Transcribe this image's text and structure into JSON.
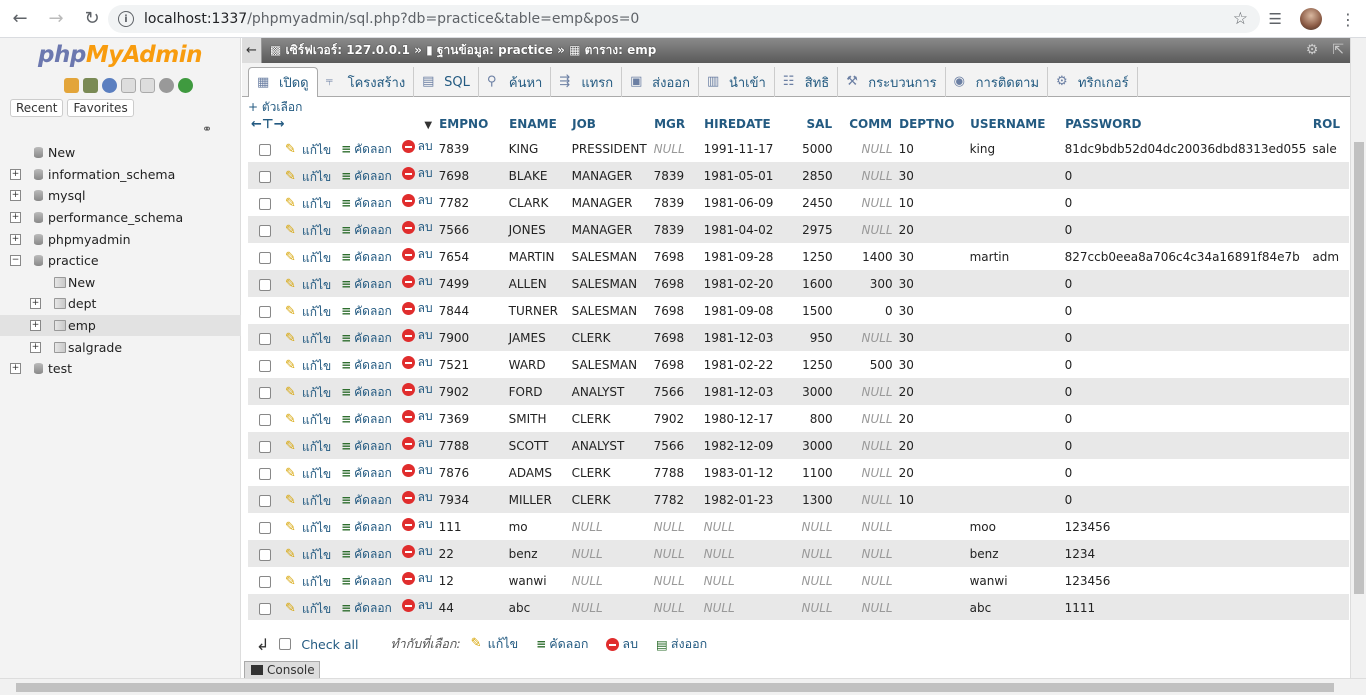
{
  "browser": {
    "url_host": "localhost:1337",
    "url_path": "/phpmyadmin/sql.php?db=practice&table=emp&pos=0"
  },
  "sidebar": {
    "logo_php": "php",
    "logo_myadmin": "MyAdmin",
    "tabs": [
      "Recent",
      "Favorites"
    ],
    "tree": [
      {
        "label": "New",
        "level": 0,
        "expander": "",
        "icon": "new-db-icon"
      },
      {
        "label": "information_schema",
        "level": 0,
        "expander": "+",
        "icon": "database-icon"
      },
      {
        "label": "mysql",
        "level": 0,
        "expander": "+",
        "icon": "database-icon"
      },
      {
        "label": "performance_schema",
        "level": 0,
        "expander": "+",
        "icon": "database-icon"
      },
      {
        "label": "phpmyadmin",
        "level": 0,
        "expander": "+",
        "icon": "database-icon"
      },
      {
        "label": "practice",
        "level": 0,
        "expander": "−",
        "icon": "database-icon"
      },
      {
        "label": "New",
        "level": 1,
        "expander": "",
        "icon": "new-table-icon"
      },
      {
        "label": "dept",
        "level": 1,
        "expander": "+",
        "icon": "table-icon"
      },
      {
        "label": "emp",
        "level": 1,
        "expander": "+",
        "icon": "table-icon",
        "selected": true
      },
      {
        "label": "salgrade",
        "level": 1,
        "expander": "+",
        "icon": "table-icon"
      },
      {
        "label": "test",
        "level": 0,
        "expander": "+",
        "icon": "database-icon"
      }
    ]
  },
  "breadcrumb": {
    "server": "เซิร์ฟเวอร์: 127.0.0.1",
    "database": "ฐานข้อมูล: practice",
    "table": "ตาราง: emp"
  },
  "tabs": [
    {
      "label": "เปิดดู",
      "icon": "browse-icon",
      "active": true
    },
    {
      "label": "โครงสร้าง",
      "icon": "structure-icon"
    },
    {
      "label": "SQL",
      "icon": "sql-icon"
    },
    {
      "label": "ค้นหา",
      "icon": "search-icon"
    },
    {
      "label": "แทรก",
      "icon": "insert-icon"
    },
    {
      "label": "ส่งออก",
      "icon": "export-icon"
    },
    {
      "label": "นำเข้า",
      "icon": "import-icon"
    },
    {
      "label": "สิทธิ",
      "icon": "privileges-icon"
    },
    {
      "label": "กระบวนการ",
      "icon": "operations-icon"
    },
    {
      "label": "การติดตาม",
      "icon": "tracking-icon"
    },
    {
      "label": "ทริกเกอร์",
      "icon": "triggers-icon"
    }
  ],
  "options_label": "+ ตัวเลือก",
  "table": {
    "columns": [
      "EMPNO",
      "ENAME",
      "JOB",
      "MGR",
      "HIREDATE",
      "SAL",
      "COMM",
      "DEPTNO",
      "USERNAME",
      "PASSWORD",
      "ROL"
    ],
    "action_edit": "แก้ไข",
    "action_copy": "คัดลอก",
    "action_delete": "ลบ",
    "null_text": "NULL",
    "rows": [
      [
        "7839",
        "KING",
        "PRESSIDENT",
        "NULL",
        "1991-11-17",
        "5000",
        "NULL",
        "10",
        "king",
        "81dc9bdb52d04dc20036dbd8313ed055",
        "sale"
      ],
      [
        "7698",
        "BLAKE",
        "MANAGER",
        "7839",
        "1981-05-01",
        "2850",
        "NULL",
        "30",
        "",
        "0",
        ""
      ],
      [
        "7782",
        "CLARK",
        "MANAGER",
        "7839",
        "1981-06-09",
        "2450",
        "NULL",
        "10",
        "",
        "0",
        ""
      ],
      [
        "7566",
        "JONES",
        "MANAGER",
        "7839",
        "1981-04-02",
        "2975",
        "NULL",
        "20",
        "",
        "0",
        ""
      ],
      [
        "7654",
        "MARTIN",
        "SALESMAN",
        "7698",
        "1981-09-28",
        "1250",
        "1400",
        "30",
        "martin",
        "827ccb0eea8a706c4c34a16891f84e7b",
        "adm"
      ],
      [
        "7499",
        "ALLEN",
        "SALESMAN",
        "7698",
        "1981-02-20",
        "1600",
        "300",
        "30",
        "",
        "0",
        ""
      ],
      [
        "7844",
        "TURNER",
        "SALESMAN",
        "7698",
        "1981-09-08",
        "1500",
        "0",
        "30",
        "",
        "0",
        ""
      ],
      [
        "7900",
        "JAMES",
        "CLERK",
        "7698",
        "1981-12-03",
        "950",
        "NULL",
        "30",
        "",
        "0",
        ""
      ],
      [
        "7521",
        "WARD",
        "SALESMAN",
        "7698",
        "1981-02-22",
        "1250",
        "500",
        "30",
        "",
        "0",
        ""
      ],
      [
        "7902",
        "FORD",
        "ANALYST",
        "7566",
        "1981-12-03",
        "3000",
        "NULL",
        "20",
        "",
        "0",
        ""
      ],
      [
        "7369",
        "SMITH",
        "CLERK",
        "7902",
        "1980-12-17",
        "800",
        "NULL",
        "20",
        "",
        "0",
        ""
      ],
      [
        "7788",
        "SCOTT",
        "ANALYST",
        "7566",
        "1982-12-09",
        "3000",
        "NULL",
        "20",
        "",
        "0",
        ""
      ],
      [
        "7876",
        "ADAMS",
        "CLERK",
        "7788",
        "1983-01-12",
        "1100",
        "NULL",
        "20",
        "",
        "0",
        ""
      ],
      [
        "7934",
        "MILLER",
        "CLERK",
        "7782",
        "1982-01-23",
        "1300",
        "NULL",
        "10",
        "",
        "0",
        ""
      ],
      [
        "111",
        "mo",
        "NULL",
        "NULL",
        "NULL",
        "NULL",
        "NULL",
        "",
        "moo",
        "123456",
        ""
      ],
      [
        "22",
        "benz",
        "NULL",
        "NULL",
        "NULL",
        "NULL",
        "NULL",
        "",
        "benz",
        "1234",
        ""
      ],
      [
        "12",
        "wanwi",
        "NULL",
        "NULL",
        "NULL",
        "NULL",
        "NULL",
        "",
        "wanwi",
        "123456",
        ""
      ],
      [
        "44",
        "abc",
        "NULL",
        "NULL",
        "NULL",
        "NULL",
        "NULL",
        "",
        "abc",
        "1111",
        ""
      ]
    ]
  },
  "bulk": {
    "check_all": "Check all",
    "with_selected": "ทำกับที่เลือก:",
    "edit": "แก้ไข",
    "copy": "คัดลอก",
    "delete": "ลบ",
    "export": "ส่งออก"
  },
  "console_label": "Console",
  "colors": {
    "link": "#235a81",
    "logo_php": "#6c78af",
    "logo_myadmin": "#f89c0e",
    "row_alt": "#e8e8e8",
    "delete": "#e02d2d"
  }
}
